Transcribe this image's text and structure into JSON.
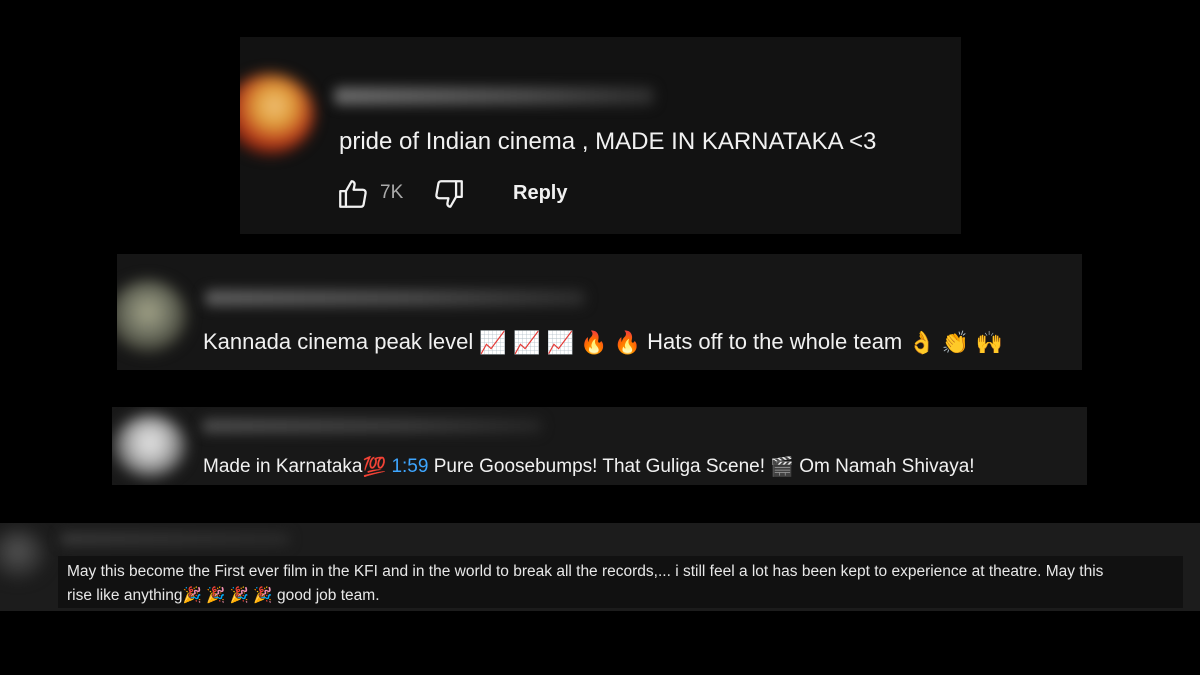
{
  "comments": [
    {
      "text": "pride of Indian cinema , MADE IN KARNATAKA <3",
      "likes": "7K",
      "reply_label": "Reply"
    },
    {
      "text_part1": "Kannada cinema peak level",
      "emojis_part1": [
        "📈",
        "📈",
        "📈",
        "🔥",
        "🔥"
      ],
      "text_part2": "Hats off to the whole team",
      "emojis_part2": [
        "👌",
        "👏",
        "🙌"
      ]
    },
    {
      "text_part1": "Made in Karnataka",
      "emoji_1": "💯",
      "timestamp": "1:59",
      "text_part2": "Pure Goosebumps! That Guliga Scene!",
      "emoji_2": "🎬",
      "text_part3": "Om Namah Shivaya!"
    },
    {
      "line1": "May this become the First ever film in the KFI and in the world to break all the records,... i still feel a lot has been kept to experience at theatre. May this",
      "line2_start": "rise like anything",
      "emojis": [
        "🎉",
        "🎉",
        "🎉",
        "🎉"
      ],
      "line2_end": "good job team."
    }
  ],
  "icons": {
    "like": "thumbs-up-icon",
    "dislike": "thumbs-down-icon"
  },
  "colors": {
    "background": "#000000",
    "card": "#141414",
    "text": "#f1f1f1",
    "secondary_text": "#aaaaaa",
    "timestamp_link": "#3ea6ff"
  }
}
